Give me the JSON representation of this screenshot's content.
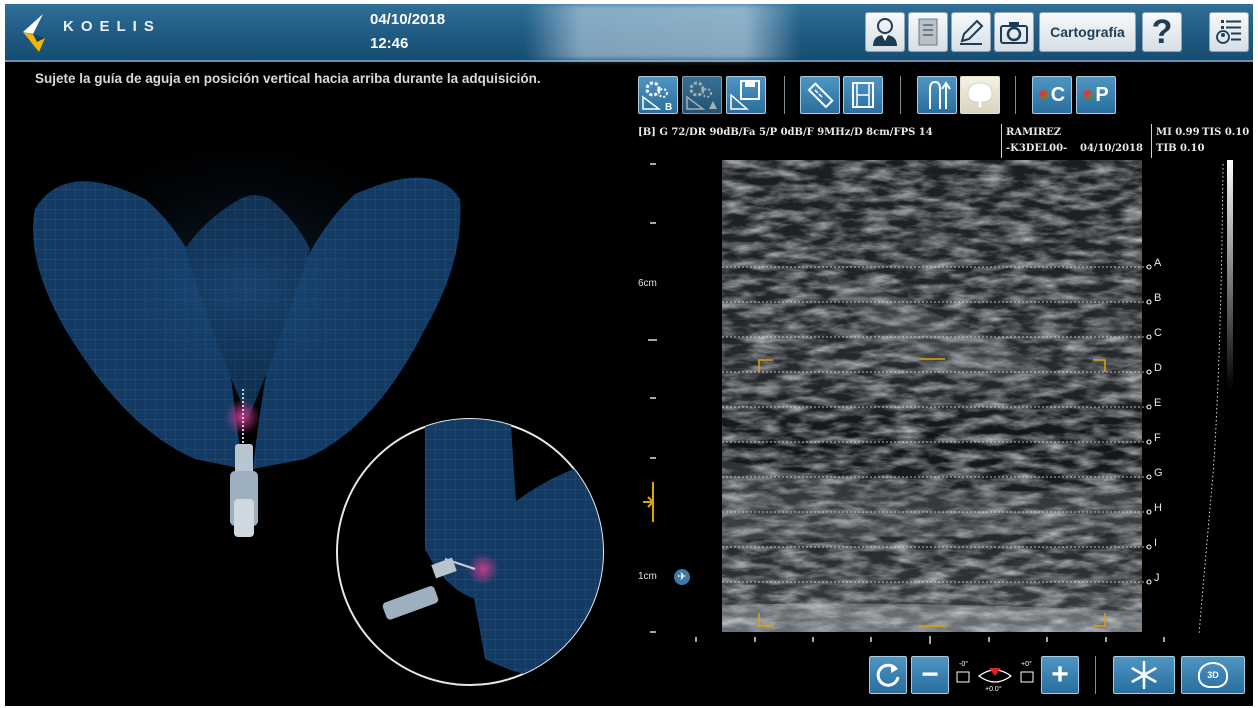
{
  "header": {
    "logo_text": "KOELIS",
    "date": "04/10/2018",
    "time": "12:46",
    "buttons": {
      "patient": "patient-icon",
      "report": "report-icon",
      "annotate": "pencil-icon",
      "capture": "camera-icon",
      "cartography": "Cartografía",
      "help": "?",
      "list": "list-icon"
    }
  },
  "instruction": "Sujete la guía de aguja en posición vertical hacia arriba durante la adquisición.",
  "toolbar": {
    "items": [
      "settings-b-icon",
      "settings-doppler-icon",
      "save-settings-icon",
      "measure-icon",
      "film-icon",
      "needle-guide-icon",
      "prostate-icon",
      "C",
      "P"
    ]
  },
  "ultrasound": {
    "params": "[B] G 72/DR 90dB/Fa 5/P 0dB/F 9MHz/D 8cm/FPS 14",
    "patient_name": "RAMIREZ",
    "patient_id": "-K3DEL00-",
    "date": "04/10/2018",
    "mi": "MI 0.99",
    "tis": "TIS 0.10",
    "tib": "TIB 0.10",
    "depth_label_top": "6cm",
    "depth_label_bottom": "1cm",
    "zones": [
      "A",
      "B",
      "C",
      "D",
      "E",
      "F",
      "G",
      "H",
      "I",
      "J"
    ]
  },
  "controls": {
    "rotate": "rotate-icon",
    "minus": "−",
    "angle_left": "-0°",
    "angle_right": "+0°",
    "angle_center": "+0.0°",
    "plus": "+",
    "freeze": "snowflake-icon",
    "view_3d": "3D"
  },
  "colors": {
    "header": "#1f5a82",
    "button_blue": "#2a6f9f",
    "marker": "#e0a400",
    "model": "#1f5f9a",
    "lesion": "#b03a7a"
  }
}
